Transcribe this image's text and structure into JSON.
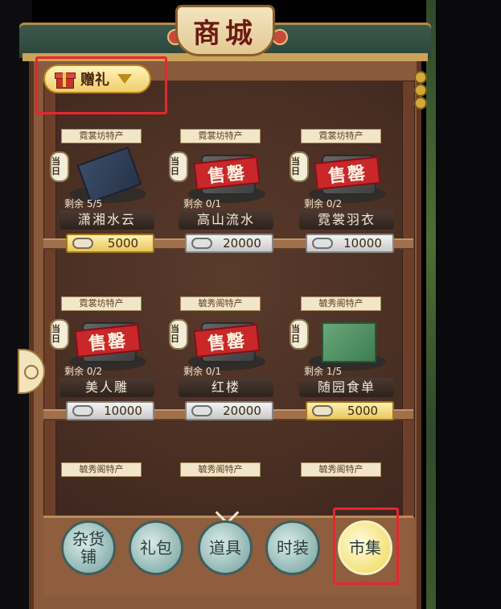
{
  "title": "商城",
  "dropdown": {
    "label": "赠礼",
    "icon": "gift-box-icon"
  },
  "items": [
    {
      "tag": "霓裳坊特产",
      "lantern": false,
      "lantern_text": "",
      "remain": "剩余 5/5",
      "name": "潇湘水云",
      "price": "5000",
      "price_style": "gold",
      "sold_out": false
    },
    {
      "tag": "霓裳坊特产",
      "lantern": true,
      "lantern_text": "当日",
      "remain": "剩余 0/1",
      "name": "高山流水",
      "price": "20000",
      "price_style": "silver",
      "sold_out": true
    },
    {
      "tag": "霓裳坊特产",
      "lantern": true,
      "lantern_text": "当日",
      "remain": "剩余 0/2",
      "name": "霓裳羽衣",
      "price": "10000",
      "price_style": "silver",
      "sold_out": true
    },
    {
      "tag": "霓裳坊特产",
      "lantern": true,
      "lantern_text": "当日",
      "remain": "剩余 0/2",
      "name": "美人雕",
      "price": "10000",
      "price_style": "silver",
      "sold_out": true
    },
    {
      "tag": "毓秀阁特产",
      "lantern": true,
      "lantern_text": "当日",
      "remain": "剩余 0/1",
      "name": "红楼",
      "price": "20000",
      "price_style": "silver",
      "sold_out": true
    },
    {
      "tag": "毓秀阁特产",
      "lantern": true,
      "lantern_text": "当日",
      "remain": "剩余 1/5",
      "name": "随园食单",
      "price": "5000",
      "price_style": "gold",
      "sold_out": false
    },
    {
      "tag": "毓秀阁特产"
    },
    {
      "tag": "毓秀阁特产"
    },
    {
      "tag": "毓秀阁特产"
    }
  ],
  "first_lantern_text": "当日",
  "sold_out_label": "售罄",
  "nav": [
    {
      "label": "杂货铺",
      "active": false
    },
    {
      "label": "礼包",
      "active": false
    },
    {
      "label": "道具",
      "active": false
    },
    {
      "label": "时装",
      "active": false
    },
    {
      "label": "市集",
      "active": true
    }
  ],
  "colors": {
    "highlight": "#e8262e",
    "gold_price": "#f0cf6a",
    "sold_out": "#c9272a"
  }
}
